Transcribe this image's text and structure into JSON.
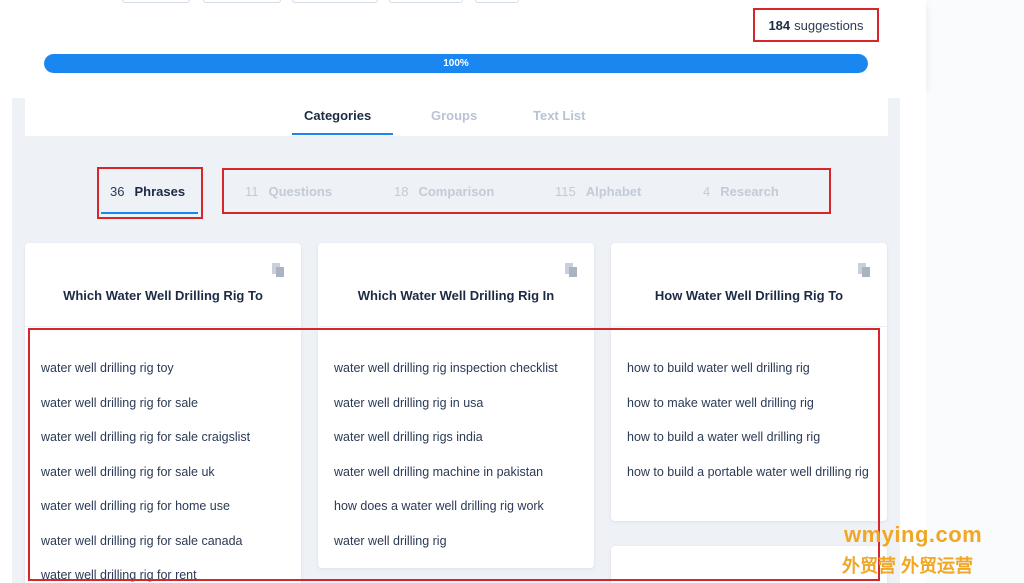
{
  "suggestions": {
    "count": "184",
    "label": "suggestions"
  },
  "progress": {
    "value": 100,
    "label": "100%"
  },
  "main_tabs": [
    {
      "label": "Categories",
      "active": true
    },
    {
      "label": "Groups",
      "active": false
    },
    {
      "label": "Text List",
      "active": false
    }
  ],
  "sub_tabs": [
    {
      "count": "36",
      "label": "Phrases",
      "active": true
    },
    {
      "count": "11",
      "label": "Questions",
      "active": false
    },
    {
      "count": "18",
      "label": "Comparison",
      "active": false
    },
    {
      "count": "115",
      "label": "Alphabet",
      "active": false
    },
    {
      "count": "4",
      "label": "Research",
      "active": false
    }
  ],
  "cards": [
    {
      "title": "Which Water Well Drilling Rig To",
      "icon": "copy-icon",
      "items": [
        "water well drilling rig toy",
        "water well drilling rig for sale",
        "water well drilling rig for sale craigslist",
        "water well drilling rig for sale uk",
        "water well drilling rig for home use",
        "water well drilling rig for sale canada",
        "water well drilling rig for rent"
      ]
    },
    {
      "title": "Which Water Well Drilling Rig In",
      "icon": "copy-icon",
      "items": [
        "water well drilling rig inspection checklist",
        "water well drilling rig in usa",
        "water well drilling rigs india",
        "water well drilling machine in pakistan",
        "how does a water well drilling rig work",
        "water well drilling rig"
      ]
    },
    {
      "title": "How Water Well Drilling Rig To",
      "icon": "copy-icon",
      "items": [
        "how to build water well drilling rig",
        "how to make water well drilling rig",
        "how to build a water well drilling rig",
        "how to build a portable water well drilling rig"
      ]
    }
  ],
  "watermark": {
    "line1": "wmying.com",
    "line2": "外贸营 外贸运营"
  },
  "colors": {
    "accent": "#1a86ef",
    "highlight": "#d7262b",
    "watermark": "#f0a726"
  }
}
